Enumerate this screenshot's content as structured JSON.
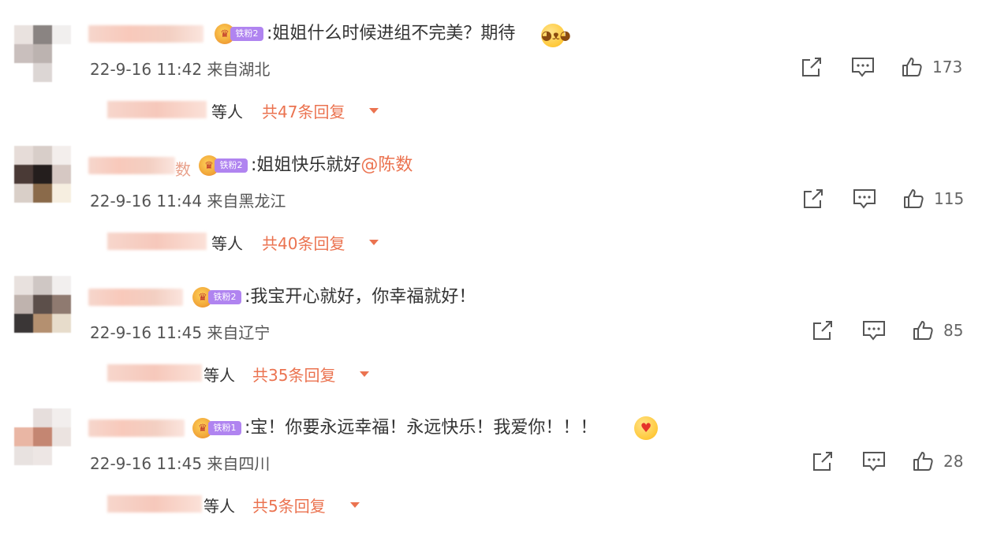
{
  "comments": [
    {
      "text": ":姐姐什么时候进组不完美？期待",
      "mention": "",
      "badge": "铁粉2",
      "time_location": "22-9-16 11:42  来自湖北",
      "likes": "173",
      "reply_who": "等人",
      "reply_count": "共47条回复",
      "emoji": "doge-emoji"
    },
    {
      "text": ":姐姐快乐就好",
      "mention": "@陈数",
      "badge": "铁粉2",
      "name_tail": "数",
      "time_location": "22-9-16 11:44  来自黑龙江",
      "likes": "115",
      "reply_who": "等人",
      "reply_count": "共40条回复"
    },
    {
      "text": ":我宝开心就好，你幸福就好！",
      "mention": "",
      "badge": "铁粉2",
      "time_location": "22-9-16 11:45  来自辽宁",
      "likes": "85",
      "reply_who": "等人",
      "reply_count": "共35条回复"
    },
    {
      "text": ":宝！你要永远幸福！永远快乐！我爱你！！！",
      "mention": "",
      "badge": "铁粉1",
      "time_location": "22-9-16 11:45  来自四川",
      "likes": "28",
      "reply_who": "等人",
      "reply_count": "共5条回复",
      "emoji": "love-emoji"
    }
  ],
  "icons": {
    "share": "share-icon",
    "comment": "comment-icon",
    "like": "thumbs-up-icon",
    "expand": "caret-down-icon"
  },
  "colors": {
    "accent": "#eb7350",
    "badge": "#b084f0",
    "meta_text": "#555555"
  }
}
